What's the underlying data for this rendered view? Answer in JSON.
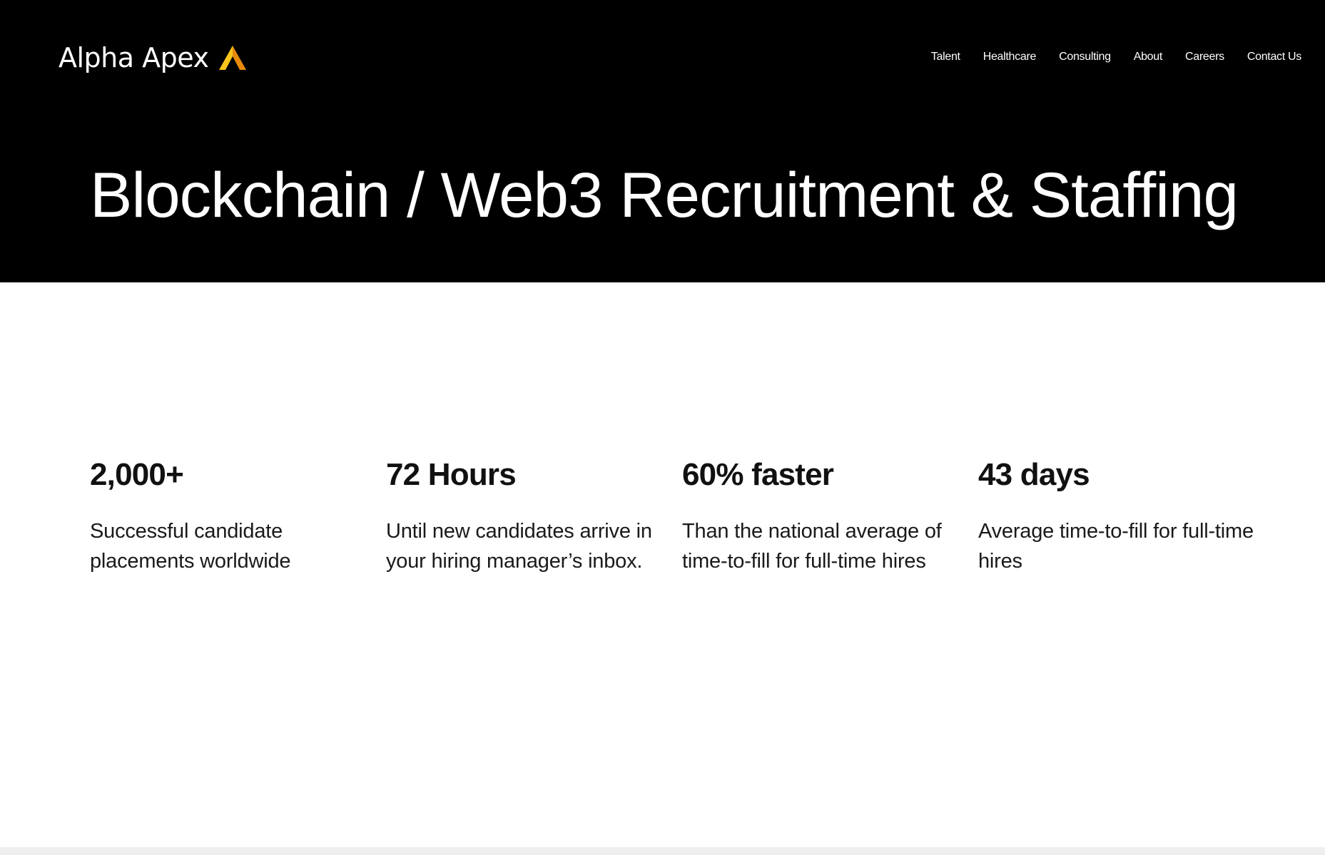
{
  "brand": {
    "name": "Alpha Apex",
    "logo_icon": "apex-triangle-icon",
    "logo_color_light": "#f9c51c",
    "logo_color_dark": "#e8890c"
  },
  "nav": {
    "items": [
      "Talent",
      "Healthcare",
      "Consulting",
      "About",
      "Careers",
      "Contact Us"
    ]
  },
  "hero": {
    "title": "Blockchain / Web3 Recruitment & Staffing",
    "background": "#000000"
  },
  "stats": [
    {
      "value": "2,000+",
      "description": "Successful candidate placements worldwide"
    },
    {
      "value": "72 Hours",
      "description": "Until new candidates arrive in your hiring manager’s inbox."
    },
    {
      "value": "60% faster",
      "description": "Than the national average of time-to-fill for full-time hires"
    },
    {
      "value": "43 days",
      "description": "Average time-to-fill for full-time hires"
    }
  ]
}
